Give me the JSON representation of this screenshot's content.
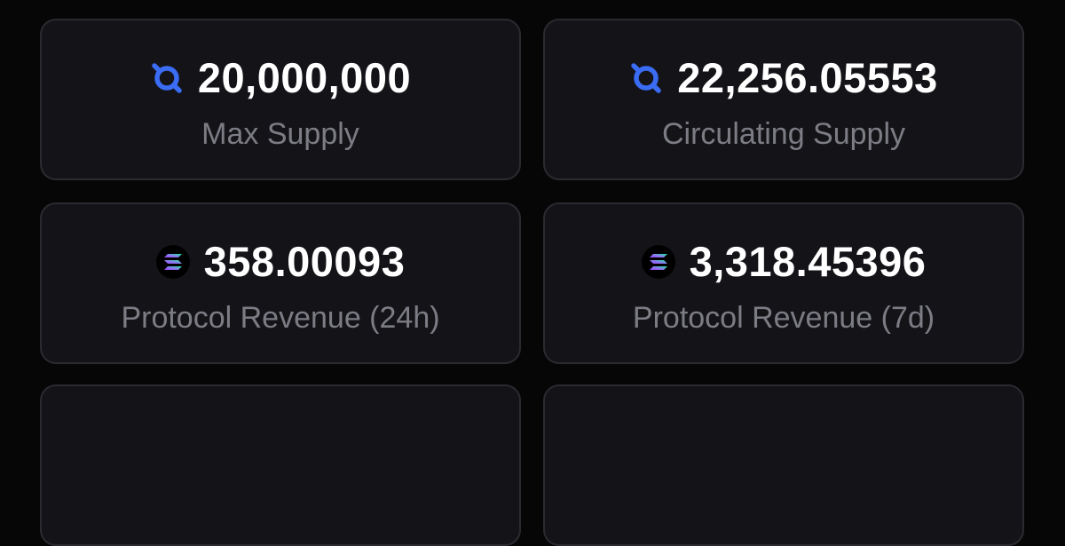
{
  "stats": [
    {
      "value": "20,000,000",
      "label": "Max Supply",
      "icon": "token-logo-icon"
    },
    {
      "value": "22,256.05553",
      "label": "Circulating Supply",
      "icon": "token-logo-icon"
    },
    {
      "value": "358.00093",
      "label": "Protocol Revenue (24h)",
      "icon": "solana-icon"
    },
    {
      "value": "3,318.45396",
      "label": "Protocol Revenue (7d)",
      "icon": "solana-icon"
    }
  ],
  "colors": {
    "background": "#060607",
    "card": "#141418",
    "card_border": "#2a2a30",
    "value_text": "#ffffff",
    "label_text": "#7c7c85",
    "token_blue": "#3a6cf4"
  }
}
